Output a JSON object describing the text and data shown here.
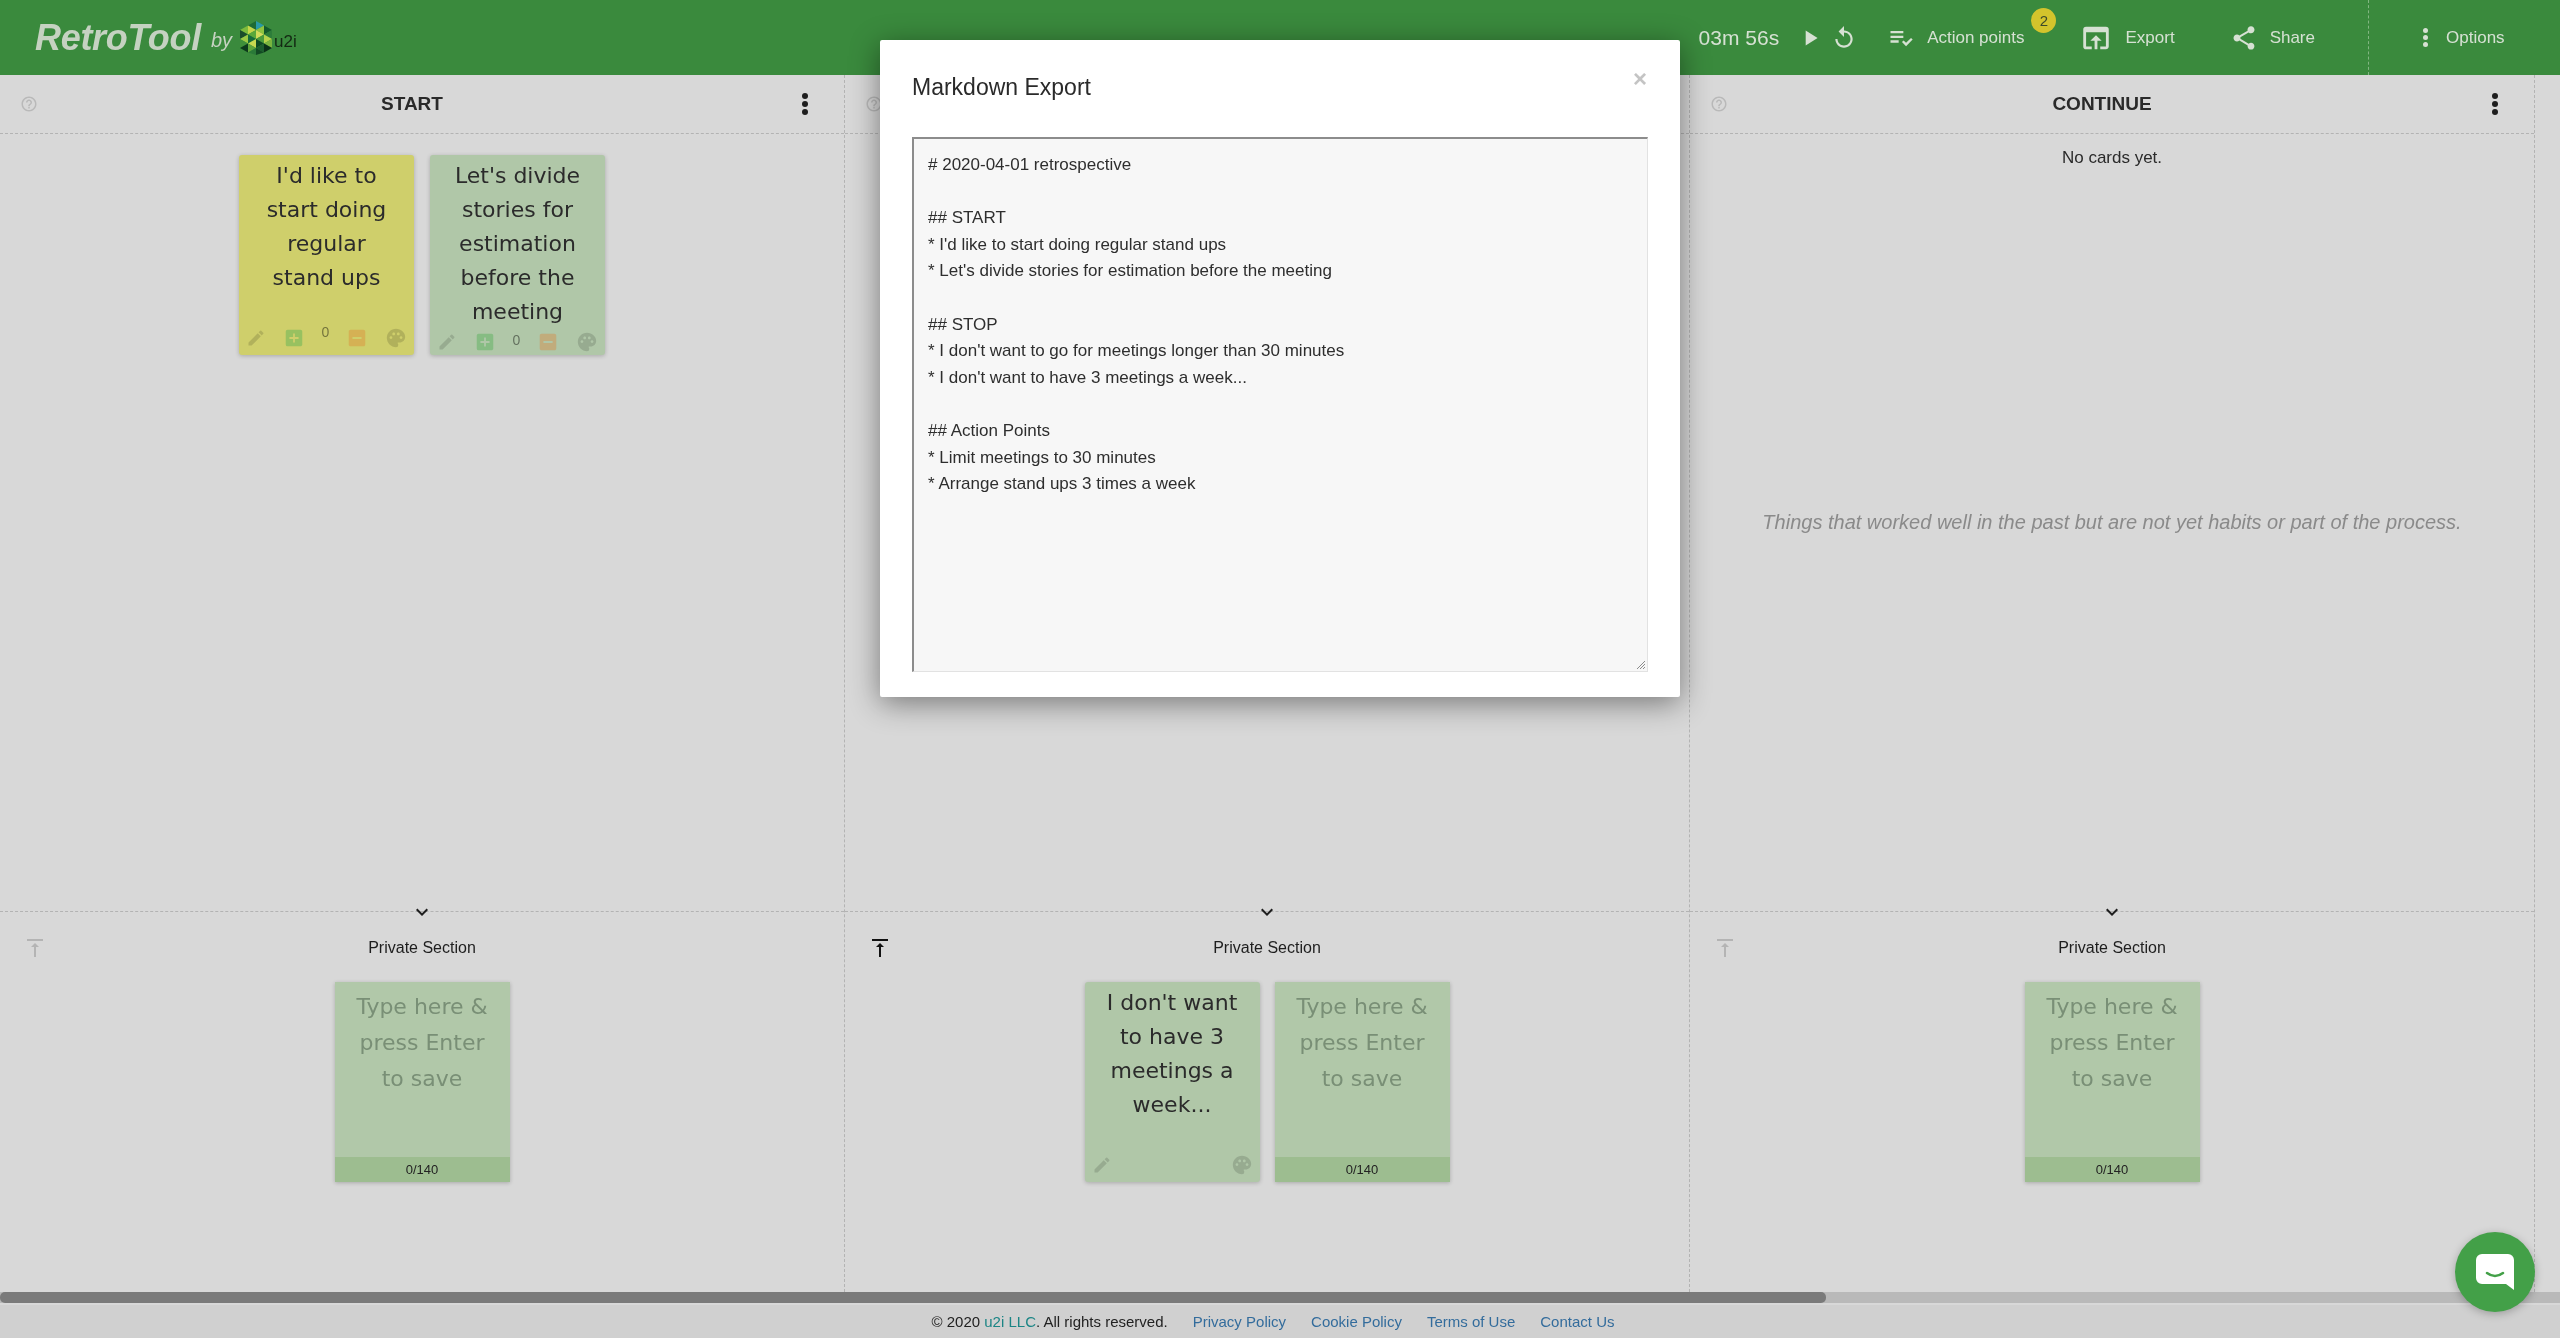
{
  "header": {
    "logo": "RetroTool",
    "by": "by",
    "partner": "u2i",
    "timer": "03m 56s",
    "actions": [
      {
        "kind": "action_points",
        "label": "Action points",
        "badge": "2"
      },
      {
        "kind": "export",
        "label": "Export"
      },
      {
        "kind": "share",
        "label": "Share"
      }
    ],
    "options": "Options"
  },
  "columns": [
    {
      "title": "START",
      "cards": [
        {
          "kind": "note",
          "text": "I'd like to start doing regular stand ups",
          "color": "#cfcf6b",
          "votes": "0"
        },
        {
          "kind": "note",
          "text": "Let's divide stories for estimation before the meeting",
          "color": "#b0c7a8",
          "votes": "0"
        }
      ],
      "private": {
        "label": "Private Section",
        "pinned": false,
        "cards": [
          {
            "kind": "input",
            "placeholder": "Type here & press Enter to save",
            "counter": "0/140"
          }
        ]
      }
    },
    {
      "private": {
        "label": "Private Section",
        "pinned": true,
        "cards": [
          {
            "kind": "note",
            "text": "I don't want to have 3 meetings a week...",
            "color": "#b0c7a8"
          },
          {
            "kind": "input",
            "placeholder": "Type here & press Enter to save",
            "counter": "0/140"
          }
        ]
      }
    },
    {
      "title": "CONTINUE",
      "empty_text": "No cards yet.",
      "hint": "Things that worked well in the past but are not yet habits or part of the process.",
      "private": {
        "label": "Private Section",
        "pinned": false,
        "cards": [
          {
            "kind": "input",
            "placeholder": "Type here & press Enter to save",
            "counter": "0/140"
          }
        ]
      }
    }
  ],
  "modal": {
    "title": "Markdown Export",
    "close": "×",
    "export_text": "# 2020-04-01 retrospective\n\n## START\n* I'd like to start doing regular stand ups\n* Let's divide stories for estimation before the meeting\n\n## STOP\n* I don't want to go for meetings longer than 30 minutes\n* I don't want to have 3 meetings a week...\n\n## Action Points\n* Limit meetings to 30 minutes\n* Arrange stand ups 3 times a week"
  },
  "footer": {
    "copyright": {
      "before": "© 2020 ",
      "link": "u2i LLC",
      "after": ". All rights reserved."
    },
    "links": [
      "Privacy Policy",
      "Cookie Policy",
      "Terms of Use",
      "Contact Us"
    ]
  }
}
